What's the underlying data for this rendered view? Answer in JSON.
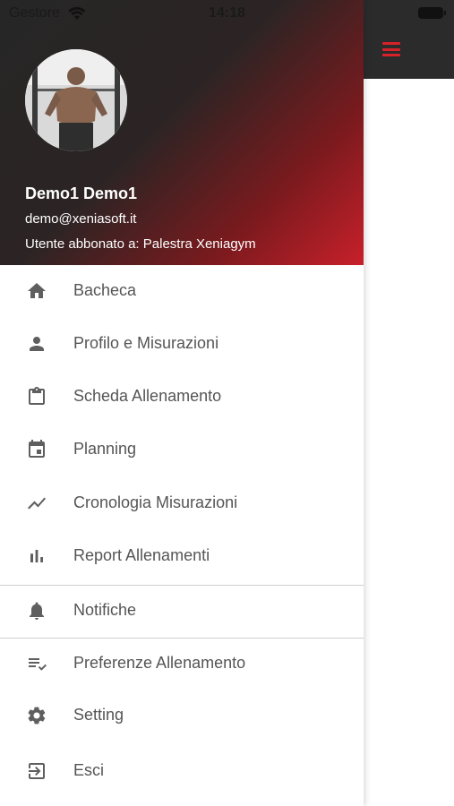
{
  "status_bar": {
    "carrier": "Gestore",
    "time": "14:18"
  },
  "app_bar": {
    "menu_icon": "hamburger-icon",
    "accent_color": "#d8222a"
  },
  "drawer": {
    "header": {
      "name": "Demo1 Demo1",
      "email": "demo@xeniasoft.it",
      "subscription": "Utente abbonato a: Palestra Xeniagym"
    },
    "items": [
      {
        "label": "Bacheca",
        "icon": "home-icon"
      },
      {
        "label": "Profilo e Misurazioni",
        "icon": "person-icon"
      },
      {
        "label": "Scheda Allenamento",
        "icon": "clipboard-icon"
      },
      {
        "label": "Planning",
        "icon": "calendar-icon"
      },
      {
        "label": "Cronologia Misurazioni",
        "icon": "trending-icon"
      },
      {
        "label": "Report Allenamenti",
        "icon": "bar-chart-icon"
      },
      {
        "label": "Notifiche",
        "icon": "bell-icon"
      },
      {
        "label": "Preferenze Allenamento",
        "icon": "playlist-check-icon"
      },
      {
        "label": "Setting",
        "icon": "gear-icon"
      },
      {
        "label": "Esci",
        "icon": "logout-icon"
      }
    ]
  }
}
